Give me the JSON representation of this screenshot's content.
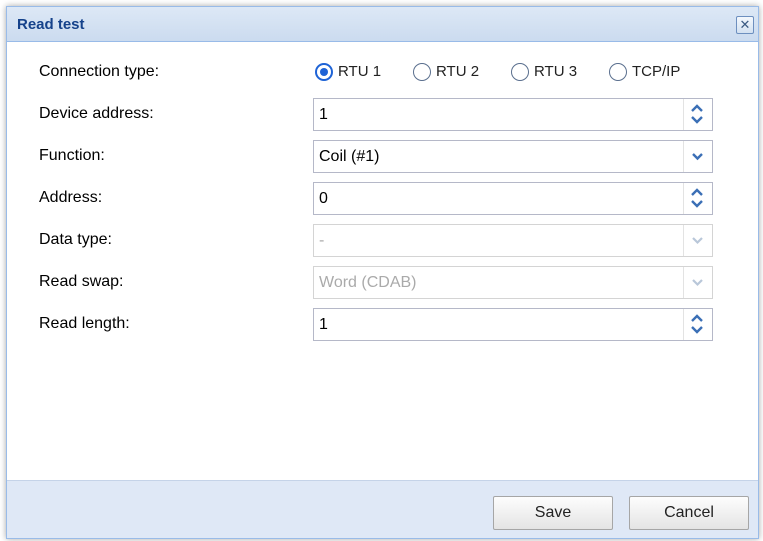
{
  "dialog": {
    "title": "Read test",
    "close_glyph": "✕"
  },
  "connection_type": {
    "label": "Connection type:",
    "options": [
      "RTU 1",
      "RTU 2",
      "RTU 3",
      "TCP/IP"
    ],
    "selected": "RTU 1"
  },
  "device_address": {
    "label": "Device address:",
    "value": "1"
  },
  "function": {
    "label": "Function:",
    "value": "Coil (#1)"
  },
  "address": {
    "label": "Address:",
    "value": "0"
  },
  "data_type": {
    "label": "Data type:",
    "value": "-",
    "disabled": true
  },
  "read_swap": {
    "label": "Read swap:",
    "value": "Word (CDAB)",
    "disabled": true
  },
  "read_length": {
    "label": "Read length:",
    "value": "1"
  },
  "footer": {
    "save_label": "Save",
    "cancel_label": "Cancel"
  },
  "colors": {
    "title_text": "#15428b",
    "titlebar_bg": "#cbdbef",
    "footer_bg": "#dfe8f6",
    "radio_selected": "#1e63d6",
    "spinner_arrow": "#3b6fb6"
  },
  "icons": {
    "close": "close-icon",
    "spinner_up": "chevron-up-icon",
    "spinner_down": "chevron-down-icon",
    "dropdown": "chevron-down-icon"
  }
}
